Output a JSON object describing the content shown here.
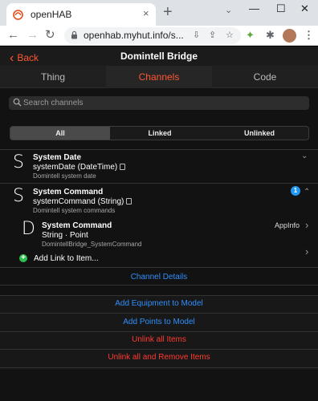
{
  "browser": {
    "tab_title": "openHAB",
    "tab_close": "×",
    "new_tab": "+",
    "url": "openhab.myhut.info/s...",
    "window_controls": {
      "collapse": "⌄",
      "minimize": "—",
      "maximize": "☐",
      "close": "✕"
    },
    "nav": {
      "back": "←",
      "forward": "→",
      "reload": "↻"
    },
    "omni_icons": {
      "install": "⇩",
      "share": "⇪",
      "bookmark": "☆"
    },
    "extensions": {
      "green": "✦",
      "puzzle": "✱",
      "menu": "⋮"
    }
  },
  "app": {
    "back_label": "Back",
    "back_chevron": "‹",
    "page_title": "Domintell Bridge",
    "tabs": [
      {
        "label": "Thing"
      },
      {
        "label": "Channels"
      },
      {
        "label": "Code"
      }
    ],
    "search": {
      "placeholder": "Search channels"
    },
    "segments": [
      {
        "label": "All"
      },
      {
        "label": "Linked"
      },
      {
        "label": "Unlinked"
      }
    ],
    "channels": [
      {
        "letter": "S",
        "title": "System Date",
        "id": "systemDate (DateTime)",
        "description": "Domintell system date",
        "chevron": "⌄"
      },
      {
        "letter": "S",
        "title": "System Command",
        "id": "systemCommand (String)",
        "description": "Domintell system commands",
        "badge": "1",
        "chevron": "⌃"
      }
    ],
    "linked_item": {
      "letter": "D",
      "title": "System Command",
      "type": "String · Point",
      "name": "DomintellBridge_SystemCommand",
      "tag": "AppInfo",
      "chevron": "›"
    },
    "add_link": {
      "icon": "+",
      "label": "Add Link to Item...",
      "chevron": "›"
    },
    "channel_details": "Channel Details",
    "actions": [
      {
        "label": "Add Equipment to Model"
      },
      {
        "label": "Add Points to Model"
      },
      {
        "label": "Unlink all Items"
      },
      {
        "label": "Unlink all and Remove Items"
      }
    ]
  },
  "colors": {
    "accent": "#ff5733",
    "link_blue": "#2f8ffb",
    "danger_red": "#ff3b30",
    "badge_blue": "#2196f3",
    "add_green": "#2ec04f"
  }
}
